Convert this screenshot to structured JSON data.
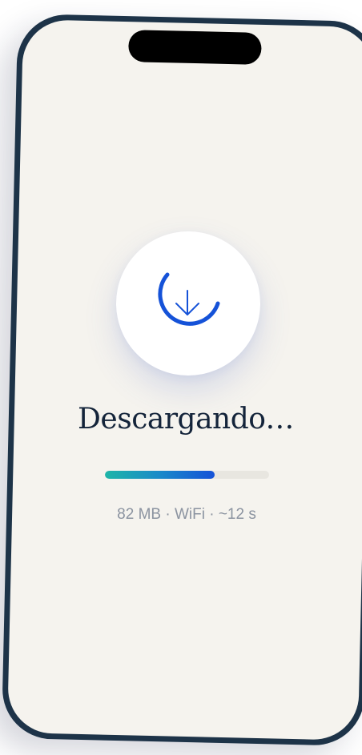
{
  "download": {
    "title": "Descargando…",
    "progress": 0.67,
    "meta": "82 MB · WiFi · ~12 s",
    "icon": "download-arrow-icon",
    "spinner_icon": "progress-ring-icon"
  },
  "colors": {
    "screen_bg": "#f5f3ee",
    "frame": "#1d3348",
    "accent_start": "#1fb5a8",
    "accent_end": "#1552d8",
    "ring": "#1552d8",
    "title": "#14243a",
    "meta": "#8b93a0"
  }
}
